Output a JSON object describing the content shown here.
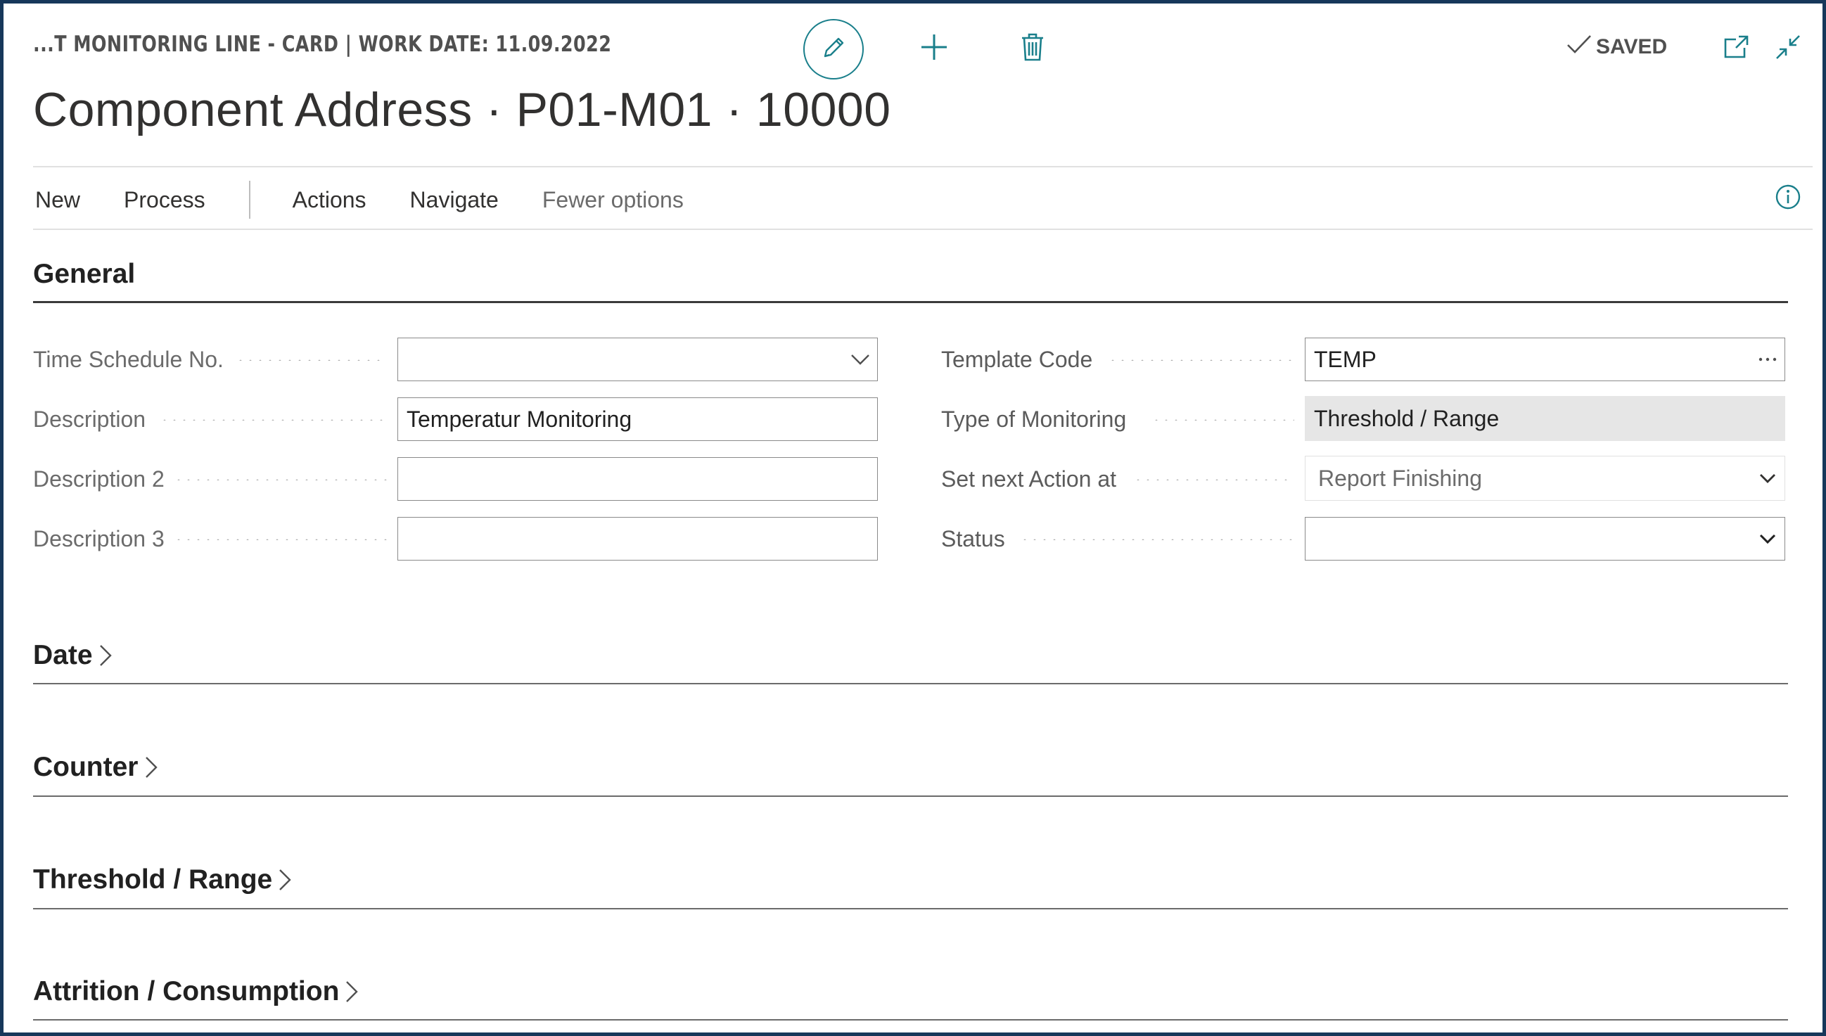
{
  "header": {
    "breadcrumb": "...T MONITORING LINE - CARD | WORK DATE: 11.09.2022",
    "title": "Component Address · P01-M01 · 10000",
    "saved_label": "SAVED"
  },
  "menu": {
    "items": [
      "New",
      "Process",
      "Actions",
      "Navigate",
      "Fewer options"
    ]
  },
  "sections": {
    "general": "General",
    "date": "Date",
    "counter": "Counter",
    "threshold": "Threshold / Range",
    "attrition": "Attrition / Consumption"
  },
  "fields": {
    "time_schedule_no": {
      "label": "Time Schedule No.",
      "value": ""
    },
    "description": {
      "label": "Description",
      "value": "Temperatur Monitoring"
    },
    "description2": {
      "label": "Description 2",
      "value": ""
    },
    "description3": {
      "label": "Description 3",
      "value": ""
    },
    "template_code": {
      "label": "Template Code",
      "value": "TEMP"
    },
    "type_of_monitoring": {
      "label": "Type of Monitoring",
      "value": "Threshold / Range"
    },
    "set_next_action_at": {
      "label": "Set next Action at",
      "value": "Report Finishing"
    },
    "status": {
      "label": "Status",
      "value": ""
    }
  },
  "icons": {
    "edit": "pencil-icon",
    "new": "plus-icon",
    "delete": "trash-icon",
    "saved": "checkmark-icon",
    "popout": "open-in-new-window-icon",
    "collapse": "collapse-icon",
    "info": "info-icon",
    "dropdown": "chevron-down-icon",
    "lookup": "ellipsis-icon",
    "expand": "chevron-right-icon"
  },
  "colors": {
    "accent": "#1a7f8b",
    "frame": "#16375a",
    "readonly_bg": "#e6e6e6"
  }
}
